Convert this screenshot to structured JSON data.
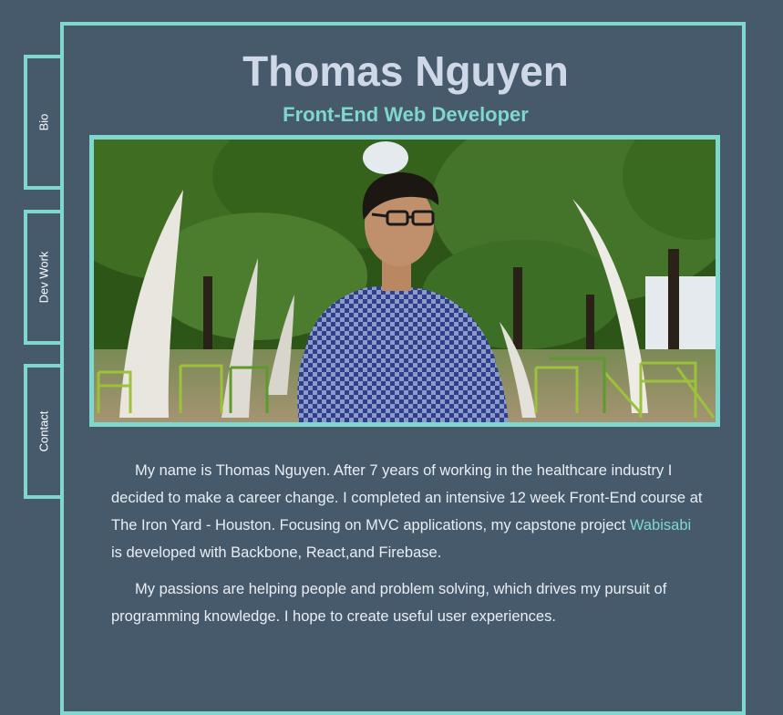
{
  "nav": {
    "tabs": [
      {
        "label": "Bio"
      },
      {
        "label": "Dev Work"
      },
      {
        "label": "Contact"
      }
    ]
  },
  "header": {
    "name": "Thomas Nguyen",
    "role": "Front-End Web Developer"
  },
  "photo": {
    "icon": "profile-photo"
  },
  "bio": {
    "p1_before": "My name is Thomas Nguyen. After 7 years of working in the healthcare industry I decided to make a career change. I completed an intensive 12 week Front-End course at The Iron Yard - Houston. Focusing on MVC applications, my capstone project ",
    "p1_link": "Wabisabi",
    "p1_after": " is developed with Backbone, React,and Firebase.",
    "p2": "My passions are helping people and problem solving, which drives my pursuit of programming knowledge. I hope to create useful user experiences."
  },
  "colors": {
    "background": "#465a6c",
    "accent": "#7fd7cf",
    "name": "#cfd8e6"
  }
}
